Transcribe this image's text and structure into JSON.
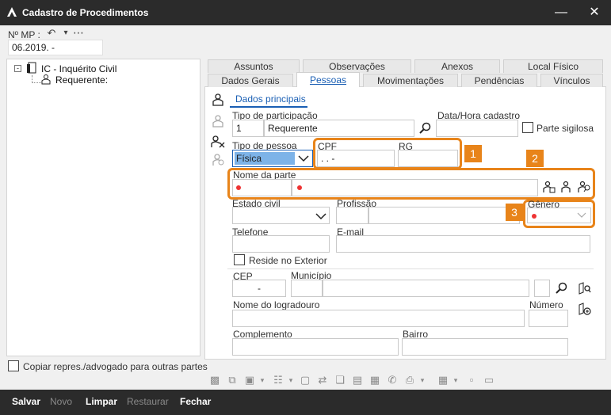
{
  "window": {
    "title": "Cadastro de Procedimentos",
    "min_icon": "minimize-icon",
    "close_icon": "close-icon"
  },
  "mp": {
    "label": "Nº MP :",
    "value": "06.2019.        -"
  },
  "tree": {
    "root": "IC - Inquérito Civil",
    "child": "Requerente:"
  },
  "tabs_row1": [
    "Assuntos",
    "Observações",
    "Anexos",
    "Local Físico"
  ],
  "tabs_row2": [
    "Dados Gerais",
    "Pessoas",
    "Movimentações",
    "Pendências",
    "Vínculos"
  ],
  "subtab": "Dados principais",
  "form": {
    "tipo_participacao_label": "Tipo de participação",
    "tipo_participacao_code": "1",
    "tipo_participacao_value": "Requerente",
    "data_hora_label": "Data/Hora cadastro",
    "parte_sigilosa_label": "Parte sigilosa",
    "tipo_pessoa_label": "Tipo de pessoa",
    "tipo_pessoa_value": "Física",
    "cpf_label": "CPF",
    "cpf_value": " .  .  -",
    "rg_label": "RG",
    "nome_parte_label": "Nome da parte",
    "estado_civil_label": "Estado civil",
    "profissao_label": "Profissão",
    "genero_label": "Gênero",
    "telefone_label": "Telefone",
    "email_label": "E-mail",
    "reside_exterior_label": "Reside no Exterior",
    "cep_label": "CEP",
    "cep_value": "-",
    "municipio_label": "Município",
    "logradouro_label": "Nome do logradouro",
    "numero_label": "Número",
    "complemento_label": "Complemento",
    "bairro_label": "Bairro"
  },
  "badges": {
    "one": "1",
    "two": "2",
    "three": "3"
  },
  "copy_label": "Copiar repres./advogado para outras partes",
  "buttons": {
    "salvar": "Salvar",
    "novo": "Novo",
    "limpar": "Limpar",
    "restaurar": "Restaurar",
    "fechar": "Fechar"
  },
  "colors": {
    "accent": "#e8841a",
    "title_bg": "#2b2b2b",
    "link": "#1a5fb4",
    "selected": "#7db3e8"
  }
}
